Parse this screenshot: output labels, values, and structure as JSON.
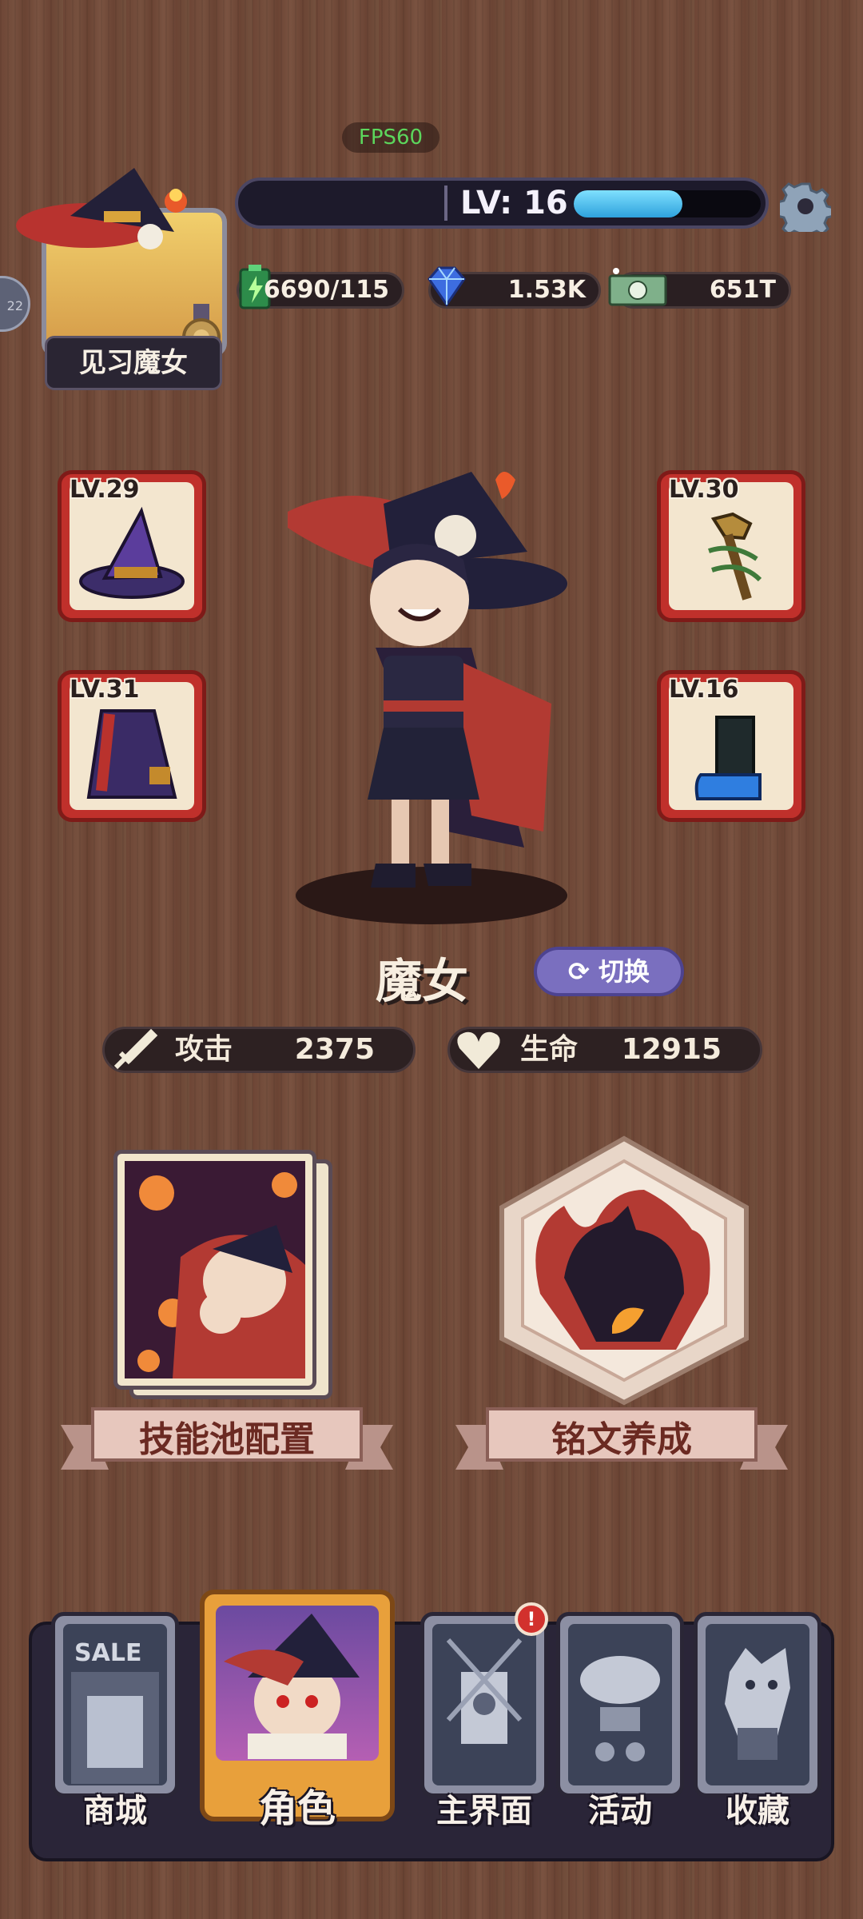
{
  "hud": {
    "fps": "FPS60",
    "rank_title": "见习魔女",
    "side_tab_text": "22",
    "level_text": "LV: 16",
    "xp_fraction": 0.58,
    "resources": [
      {
        "icon": "energy-battery-icon",
        "value": "6690/115"
      },
      {
        "icon": "diamond-icon",
        "value": "1.53K"
      },
      {
        "icon": "cash-icon",
        "value": "651T"
      }
    ]
  },
  "equipment": [
    {
      "slot": "hat",
      "level": "LV.29"
    },
    {
      "slot": "staff",
      "level": "LV.30"
    },
    {
      "slot": "cape",
      "level": "LV.31"
    },
    {
      "slot": "boots",
      "level": "LV.16"
    }
  ],
  "character": {
    "name": "魔女",
    "switch_label": "切换"
  },
  "stats": {
    "attack_label": "攻击",
    "attack_value": "2375",
    "hp_label": "生命",
    "hp_value": "12915"
  },
  "features": {
    "skill_pool_label": "技能池配置",
    "inscription_label": "铭文养成"
  },
  "nav": {
    "tabs": [
      {
        "label": "商城"
      },
      {
        "label": "角色"
      },
      {
        "label": "主界面"
      },
      {
        "label": "活动"
      },
      {
        "label": "收藏"
      }
    ],
    "active_tab": "角色",
    "shop_card_text": "SALE",
    "alert_badge": "!"
  },
  "colors": {
    "wood": "#6e4636",
    "equip_frame": "#c0302b",
    "xp_fill": "#2ea2dd",
    "active_tab": "#e8a03b",
    "switch_button": "#7a6fbf"
  }
}
